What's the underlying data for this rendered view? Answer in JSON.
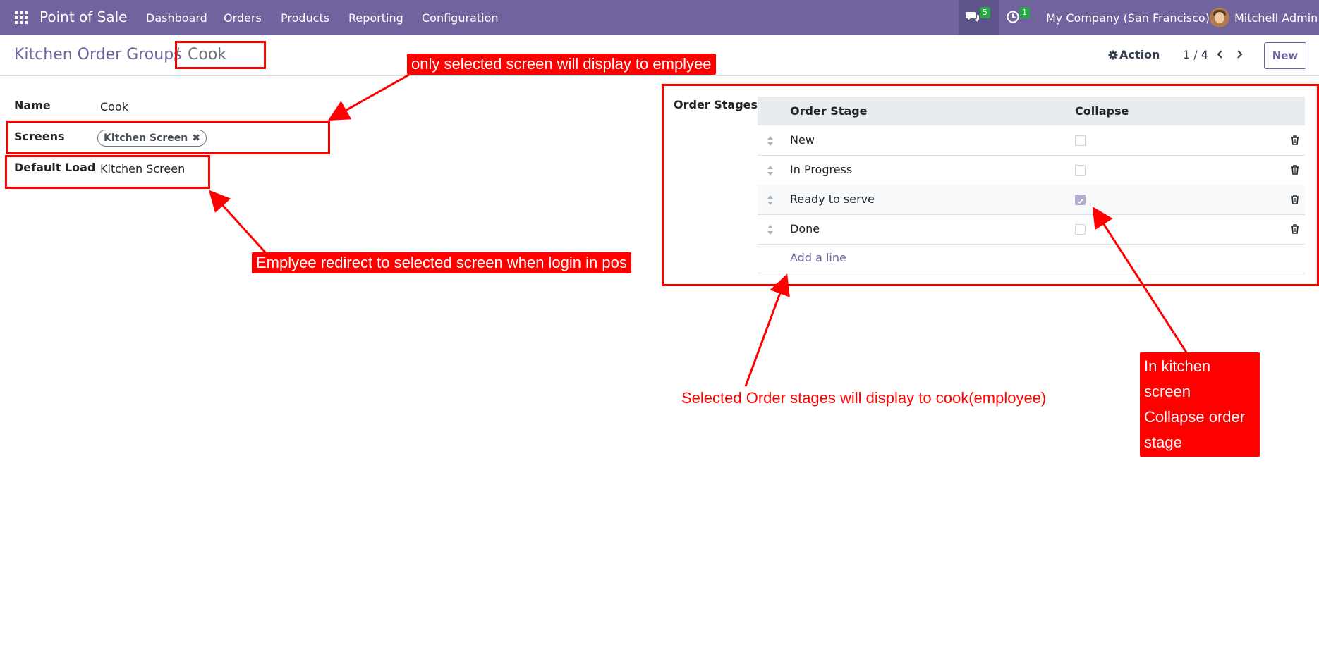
{
  "navbar": {
    "brand": "Point of Sale",
    "menu": [
      "Dashboard",
      "Orders",
      "Products",
      "Reporting",
      "Configuration"
    ],
    "chat_count": "5",
    "activity_count": "1",
    "company": "My Company (San Francisco)",
    "user": "Mitchell Admin"
  },
  "breadcrumb": {
    "parent": "Kitchen Order Groups",
    "separator": "/",
    "current": "Cook"
  },
  "control": {
    "action_label": "Action",
    "pager": "1 / 4",
    "new_label": "New"
  },
  "form": {
    "name_label": "Name",
    "name_value": "Cook",
    "screens_label": "Screens",
    "screens_tag": "Kitchen Screen",
    "default_load_label": "Default Load",
    "default_load_value": "Kitchen Screen"
  },
  "order_stages": {
    "label": "Order Stages",
    "columns": [
      "Order Stage",
      "Collapse"
    ],
    "rows": [
      {
        "stage": "New",
        "collapse": false
      },
      {
        "stage": "In Progress",
        "collapse": false
      },
      {
        "stage": "Ready to serve",
        "collapse": true
      },
      {
        "stage": "Done",
        "collapse": false
      }
    ],
    "add_line": "Add a line"
  },
  "annotations": {
    "screen_note": "only selected screen will display to emplyee",
    "redirect_note": "Emplyee redirect to selected screen when login in pos",
    "stages_note": "Selected Order stages will display to cook(employee)",
    "collapse_note_1": "In kitchen screen",
    "collapse_note_2": "Collapse order stage"
  },
  "colors": {
    "navbar": "#71639e",
    "accent": "#71639e",
    "annotation": "#ff0000"
  }
}
